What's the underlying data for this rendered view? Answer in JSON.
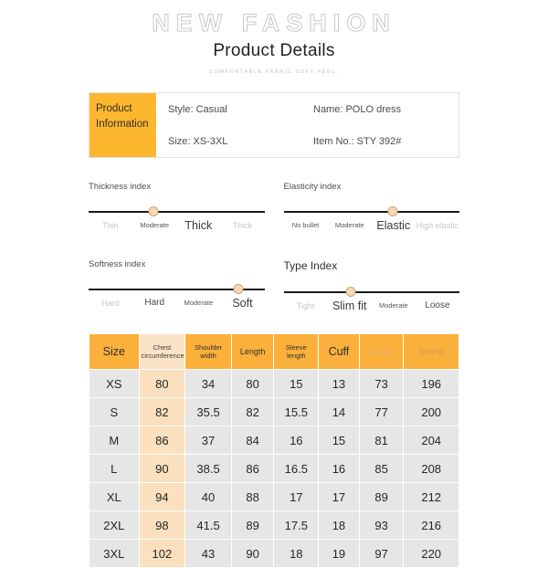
{
  "header": {
    "banner": "NEW FASHION",
    "title": "Product Details",
    "subtitle": "COMFORTABLE FABRIC SOFT FEEL."
  },
  "product_info": {
    "tag": "Product Information",
    "style": "Style: Casual",
    "name": "Name: POLO dress",
    "size": "Size: XS-3XL",
    "item_no": "Item No.: STY 392#"
  },
  "indices": [
    {
      "title": "Thickness index",
      "knob_percent": 37,
      "labels": [
        {
          "text": "Thin",
          "style": "lbl-faded"
        },
        {
          "text": "Moderate",
          "style": "lbl-small"
        },
        {
          "text": "Thick",
          "style": "lbl-active"
        },
        {
          "text": "Thick",
          "style": "lbl-faded"
        }
      ]
    },
    {
      "title": "Elasticity index",
      "knob_percent": 62,
      "labels": [
        {
          "text": "No bullet",
          "style": "lbl-small"
        },
        {
          "text": "Moderate",
          "style": "lbl-small"
        },
        {
          "text": "Elastic",
          "style": "lbl-active"
        },
        {
          "text": "High elastic",
          "style": "lbl-faded"
        }
      ]
    },
    {
      "title": "Softness index",
      "knob_percent": 85,
      "labels": [
        {
          "text": "Hard",
          "style": "lbl-faded"
        },
        {
          "text": "Hard",
          "style": "lbl-mid"
        },
        {
          "text": "Moderate",
          "style": "lbl-small"
        },
        {
          "text": "Soft",
          "style": "lbl-active"
        }
      ]
    },
    {
      "title": "Type Index",
      "knob_percent": 38,
      "labels": [
        {
          "text": "Tight",
          "style": "lbl-faded"
        },
        {
          "text": "Slim fit",
          "style": "lbl-active"
        },
        {
          "text": "Moderate",
          "style": "lbl-small"
        },
        {
          "text": "Loose",
          "style": "lbl-mid"
        }
      ]
    }
  ],
  "size_table": {
    "headers": [
      {
        "text": "Size",
        "style": "th-big"
      },
      {
        "text": "Chest circumference",
        "style": "th-small",
        "highlight": true
      },
      {
        "text": "Shoulder width",
        "style": "th-small"
      },
      {
        "text": "Length",
        "style": "th-mid"
      },
      {
        "text": "Sleeve length",
        "style": "th-small"
      },
      {
        "text": "Cuff",
        "style": "th-big"
      },
      {
        "text": "Waistline",
        "style": "th-faded"
      },
      {
        "text": "Swing",
        "style": "th-swing"
      }
    ],
    "rows": [
      [
        "XS",
        "80",
        "34",
        "80",
        "15",
        "13",
        "73",
        "196"
      ],
      [
        "S",
        "82",
        "35.5",
        "82",
        "15.5",
        "14",
        "77",
        "200"
      ],
      [
        "M",
        "86",
        "37",
        "84",
        "16",
        "15",
        "81",
        "204"
      ],
      [
        "L",
        "90",
        "38.5",
        "86",
        "16.5",
        "16",
        "85",
        "208"
      ],
      [
        "XL",
        "94",
        "40",
        "88",
        "17",
        "17",
        "89",
        "212"
      ],
      [
        "2XL",
        "98",
        "41.5",
        "89",
        "17.5",
        "18",
        "93",
        "216"
      ],
      [
        "3XL",
        "102",
        "43",
        "90",
        "18",
        "19",
        "97",
        "220"
      ]
    ],
    "highlight_column_index": 1
  },
  "colors": {
    "brand_orange": "#FBB03B",
    "tag_orange": "#FDB72E",
    "highlight_peach": "#FAE0BE",
    "cell_gray": "#E6E6E6"
  }
}
